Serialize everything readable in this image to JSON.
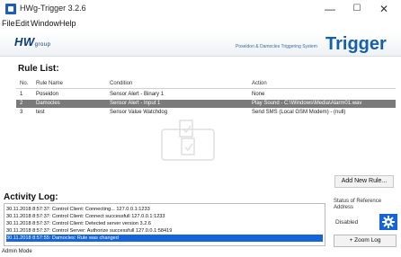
{
  "window": {
    "title": "HWg-Trigger 3.2.6"
  },
  "menu": [
    {
      "label": "File"
    },
    {
      "label": "Edit"
    },
    {
      "label": "Window"
    },
    {
      "label": "Help"
    }
  ],
  "header": {
    "logo_text": "HW",
    "logo_sub": "group",
    "tagline": "Poseidon & Damocles Triggering System",
    "title": "Trigger"
  },
  "rule_list": {
    "title": "Rule List:",
    "columns": {
      "no": "No.",
      "name": "Rule Name",
      "condition": "Condition",
      "action": "Action"
    },
    "rows": [
      {
        "no": "1",
        "name": "Poseidon",
        "condition": "Sensor Alert - Binary 1",
        "action": "None",
        "selected": false
      },
      {
        "no": "2",
        "name": "Damocles",
        "condition": "Sensor Alert - Input 1",
        "action": "Play Sound - C:\\Windows\\Media\\Alarm01.wav",
        "selected": true
      },
      {
        "no": "3",
        "name": "test",
        "condition": "Sensor Value Watchdog",
        "action": "Send SMS (Local GSM Modem) - (null)",
        "selected": false
      }
    ],
    "add_button": "Add New Rule..."
  },
  "activity_log": {
    "title": "Activity Log:",
    "lines": [
      {
        "text": "30.11.2018 8:57:37: Control Client: Connecting... 127.0.0.1:1233",
        "selected": false
      },
      {
        "text": "30.11.2018 8:57:37: Control Client: Connect successfull 127.0.0.1:1233",
        "selected": false
      },
      {
        "text": "30.11.2018 8:57:37: Control Client: Detected server version 3.2.6",
        "selected": false
      },
      {
        "text": "30.11.2018 8:57:37: Control Server: Authorize successfull 127.0.0.1:58419",
        "selected": false
      },
      {
        "text": "30.11.2018 8:57:55: Damocles: Rule was changed",
        "selected": true
      }
    ]
  },
  "status": {
    "label": "Status of Reference Address",
    "value": "Disabled",
    "gear_icon": "gear-icon",
    "zoom_button": "+ Zoom Log"
  },
  "statusbar": {
    "mode": "Admin Mode"
  },
  "colors": {
    "accent": "#1565d8",
    "selected_row": "#7a7a7a",
    "brand": "#1560a8"
  }
}
